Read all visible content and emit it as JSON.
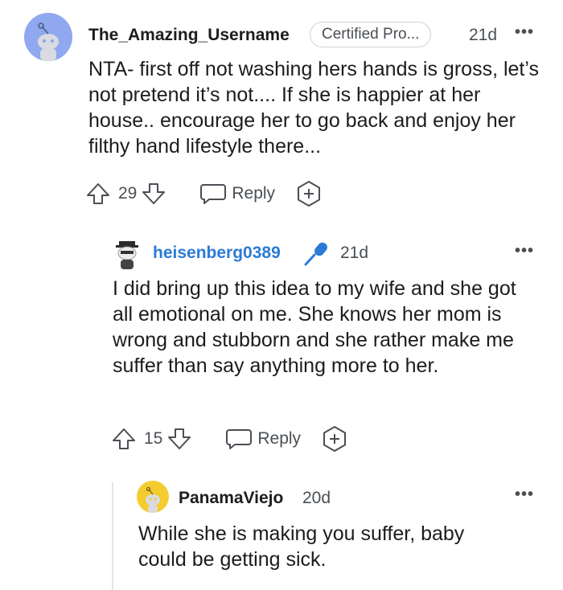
{
  "comments": [
    {
      "username": "The_Amazing_Username",
      "flair": "Certified Pro...",
      "age": "21d",
      "text": "NTA- first off not washing hers hands is gross, let’s not pretend it’s not.... If she is happier at her house.. encourage her to go back and enjoy her filthy hand lifestyle there...",
      "votes": "29",
      "reply_label": "Reply",
      "avatar_color": "#8fa8f0"
    },
    {
      "username": "heisenberg0389",
      "age": "21d",
      "text": "I did bring up this idea to my wife and she got all emotional on me. She knows her mom is wrong and stubborn and she rather make me suffer than say anything more to her.",
      "votes": "15",
      "reply_label": "Reply",
      "username_color": "#2b7bd6"
    },
    {
      "username": "PanamaViejo",
      "age": "20d",
      "text": "While she is making you suffer, baby could be getting sick.",
      "avatar_color": "#f5cc2e"
    }
  ],
  "icons": [
    "snoo-avatar-icon",
    "more-options-icon",
    "upvote-icon",
    "downvote-icon",
    "reply-bubble-icon",
    "award-icon",
    "microphone-icon"
  ]
}
